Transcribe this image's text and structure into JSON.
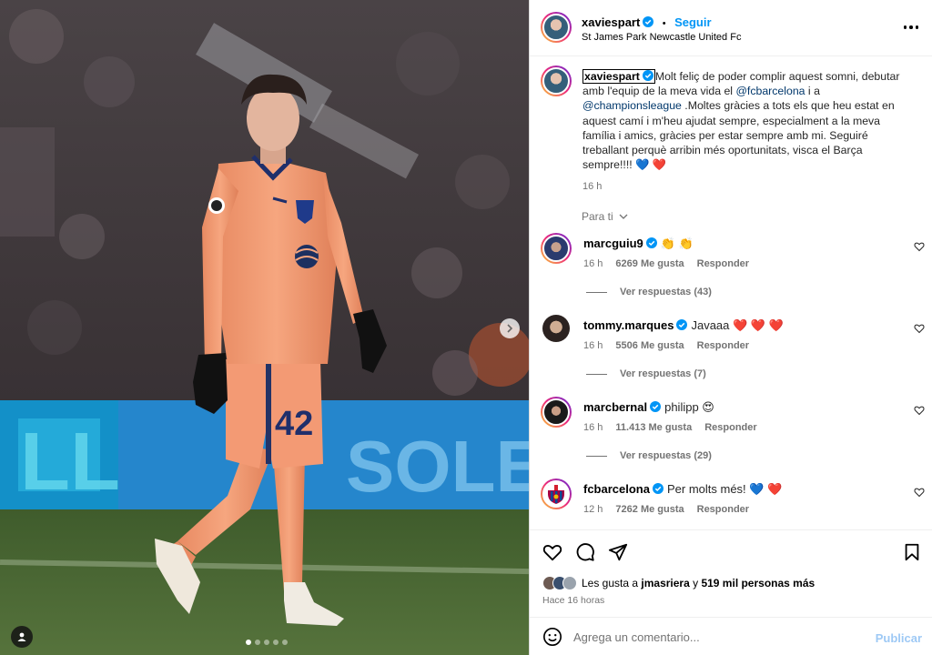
{
  "colors": {
    "accent": "#0095f6",
    "mention": "#00376b",
    "muted": "#737373",
    "kit_orange": "#f4a27c",
    "heart_red": "#ff3040",
    "heart_blue": "#3b82f6"
  },
  "post": {
    "author": "xaviespart",
    "follow_label": "Seguir",
    "separator": "•",
    "location": "St James Park Newcastle United Fc",
    "options_icon": "more-horizontal-icon",
    "carousel": {
      "total_slides": 5,
      "active_slide": 1
    }
  },
  "caption": {
    "author": "xaviespart",
    "text_1": "Molt feliç de poder complir aquest somni, debutar amb l'equip de la meva vida el ",
    "mention_1": "@fcbarcelona",
    "text_2": " i a ",
    "mention_2": "@championsleague",
    "text_3": " .Moltes gràcies a tots els que heu estat en aquest camí i m'heu ajudat sempre, especialment a la meva família i amics, gràcies per estar sempre amb mi. Seguiré treballant perquè arribin més oportunitats, visca el Barça sempre!!!! ",
    "emoji": "💙 ❤️",
    "time": "16 h"
  },
  "sort_label": "Para ti",
  "comments": [
    {
      "user": "marcguiu9",
      "text": "👏 👏",
      "time": "16 h",
      "likes": "6269 Me gusta",
      "reply": "Responder",
      "replies": "Ver respuestas (43)"
    },
    {
      "user": "tommy.marques",
      "text": "Javaaa ❤️ ❤️ ❤️",
      "time": "16 h",
      "likes": "5506 Me gusta",
      "reply": "Responder",
      "replies": "Ver respuestas (7)"
    },
    {
      "user": "marcbernal",
      "text": "philipp 😍",
      "time": "16 h",
      "likes": "11.413 Me gusta",
      "reply": "Responder",
      "replies": "Ver respuestas (29)"
    },
    {
      "user": "fcbarcelona",
      "text": "Per molts més! 💙 ❤️",
      "time": "12 h",
      "likes": "7262 Me gusta",
      "reply": "Responder"
    }
  ],
  "likes": {
    "prefix": "Les gusta a",
    "user": "jmasriera",
    "conjunction": "y",
    "others": "519 mil personas más"
  },
  "posted": "Hace 16 horas",
  "comment_input": {
    "placeholder": "Agrega un comentario...",
    "publish_label": "Publicar"
  },
  "photo": {
    "shirt_number": "42",
    "sponsor_text": "SOLE",
    "board_text": "LL"
  }
}
